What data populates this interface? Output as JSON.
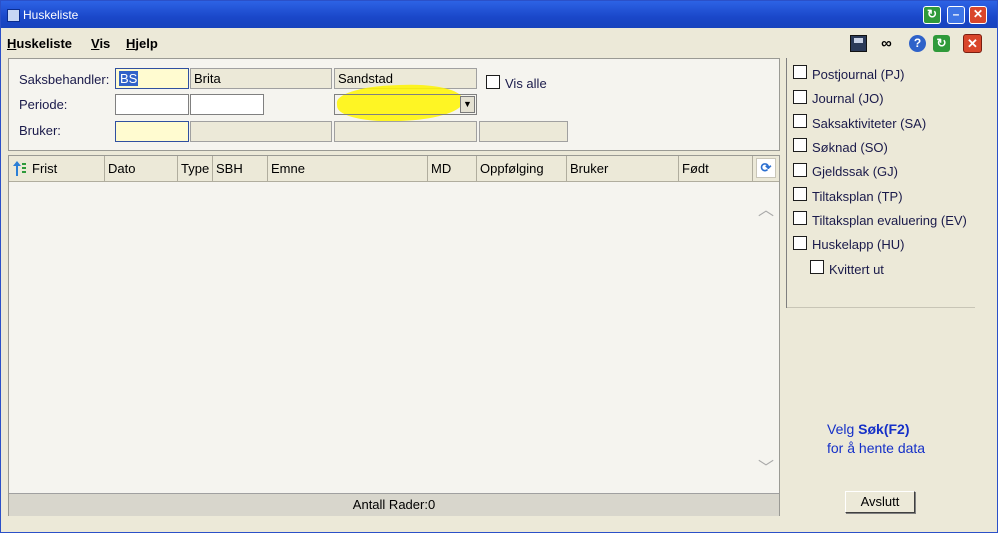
{
  "window": {
    "title": "Huskeliste"
  },
  "menu": {
    "items": [
      {
        "label": "Huskeliste",
        "accel": "H",
        "rest": "uskeliste"
      },
      {
        "label": "Vis",
        "accel": "V",
        "rest": "is"
      },
      {
        "label": "Hjelp",
        "accel": "H",
        "rest": "jelp"
      }
    ]
  },
  "toolbar": {
    "icons": [
      "save-icon",
      "binoculars-icon",
      "help-icon",
      "refresh-icon",
      "close-icon"
    ]
  },
  "search": {
    "saksbehandler_label": "Saksbehandler:",
    "saksbehandler_code": "BS",
    "saksbehandler_first": "Brita",
    "saksbehandler_last": "Sandstad",
    "vis_alle_label": "Vis alle",
    "periode_label": "Periode:",
    "periode_from": "",
    "periode_to": "",
    "bruker_label": "Bruker:",
    "bruker_value": ""
  },
  "grid": {
    "columns": [
      "Frist",
      "Dato",
      "Type",
      "SBH",
      "Emne",
      "MD",
      "Oppfølging",
      "Bruker",
      "Født"
    ],
    "rows": [],
    "footer": "Antall Rader:0"
  },
  "filters": [
    {
      "label": "Postjournal (PJ)",
      "checked": false
    },
    {
      "label": "Journal (JO)",
      "checked": false
    },
    {
      "label": "Saksaktiviteter (SA)",
      "checked": false
    },
    {
      "label": "Søknad (SO)",
      "checked": false
    },
    {
      "label": "Gjeldssak (GJ)",
      "checked": false
    },
    {
      "label": "Tiltaksplan (TP)",
      "checked": false
    },
    {
      "label": "Tiltaksplan evaluering (EV)",
      "checked": false
    },
    {
      "label": "Huskelapp (HU)",
      "checked": false
    }
  ],
  "subfilter": {
    "label": "Kvittert ut",
    "checked": false
  },
  "hint": {
    "line1_prefix": "Velg ",
    "line1_bold": "Søk(F2)",
    "line2": "for å hente data"
  },
  "buttons": {
    "avslutt": "Avslutt"
  },
  "colors": {
    "titlebar": "#1a47c9",
    "highlight": "#fff500",
    "field_yellow": "#fffbd0",
    "hint_text": "#1530c8"
  }
}
